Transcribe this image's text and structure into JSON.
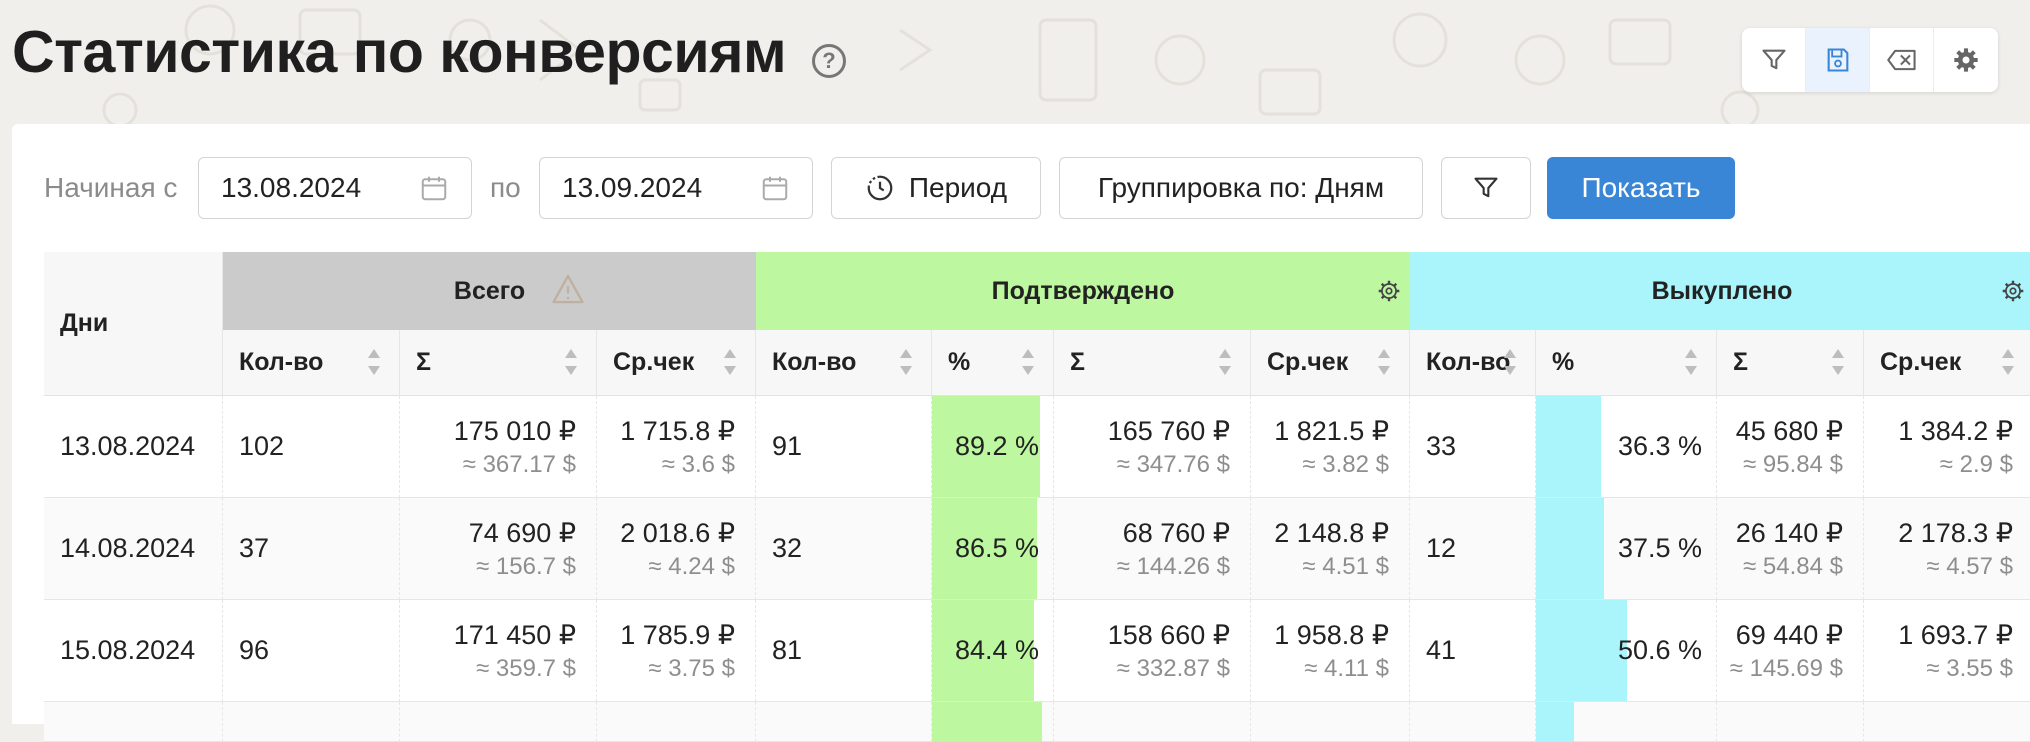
{
  "page": {
    "title": "Статистика по конверсиям"
  },
  "toolbar": {
    "filter_icon": "filter-icon",
    "save_icon": "save-icon",
    "clear_icon": "clear-icon",
    "settings_icon": "gear-icon"
  },
  "filters": {
    "from_label": "Начиная с",
    "from_value": "13.08.2024",
    "to_label": "по",
    "to_value": "13.09.2024",
    "period_label": "Период",
    "grouping_label": "Группировка по: Дням",
    "show_label": "Показать"
  },
  "table": {
    "days_header": "Дни",
    "groups": [
      {
        "label": "Всего",
        "color": "#cbcbcb"
      },
      {
        "label": "Подтверждено",
        "color": "#bdf8a0"
      },
      {
        "label": "Выкуплено",
        "color": "#a9f5fb"
      }
    ],
    "subheaders": [
      "Кол-во",
      "Σ",
      "Ср.чек",
      "Кол-во",
      "%",
      "Σ",
      "Ср.чек",
      "Кол-во",
      "%",
      "Σ",
      "Ср.чек"
    ],
    "rows": [
      {
        "date": "13.08.2024",
        "total": {
          "count": "102",
          "sum": "175 010 ₽",
          "sum_usd": "≈ 367.17 $",
          "avg": "1 715.8 ₽",
          "avg_usd": "≈ 3.6 $"
        },
        "confirmed": {
          "count": "91",
          "pct": "89.2 %",
          "pct_value": 89.2,
          "sum": "165 760 ₽",
          "sum_usd": "≈ 347.76 $",
          "avg": "1 821.5 ₽",
          "avg_usd": "≈ 3.82 $"
        },
        "bought": {
          "count": "33",
          "pct": "36.3 %",
          "pct_value": 36.3,
          "sum": "45 680 ₽",
          "sum_usd": "≈ 95.84 $",
          "avg": "1 384.2 ₽",
          "avg_usd": "≈ 2.9 $"
        }
      },
      {
        "date": "14.08.2024",
        "total": {
          "count": "37",
          "sum": "74 690 ₽",
          "sum_usd": "≈ 156.7 $",
          "avg": "2 018.6 ₽",
          "avg_usd": "≈ 4.24 $"
        },
        "confirmed": {
          "count": "32",
          "pct": "86.5 %",
          "pct_value": 86.5,
          "sum": "68 760 ₽",
          "sum_usd": "≈ 144.26 $",
          "avg": "2 148.8 ₽",
          "avg_usd": "≈ 4.51 $"
        },
        "bought": {
          "count": "12",
          "pct": "37.5 %",
          "pct_value": 37.5,
          "sum": "26 140 ₽",
          "sum_usd": "≈ 54.84 $",
          "avg": "2 178.3 ₽",
          "avg_usd": "≈ 4.57 $"
        }
      },
      {
        "date": "15.08.2024",
        "total": {
          "count": "96",
          "sum": "171 450 ₽",
          "sum_usd": "≈ 359.7 $",
          "avg": "1 785.9 ₽",
          "avg_usd": "≈ 3.75 $"
        },
        "confirmed": {
          "count": "81",
          "pct": "84.4 %",
          "pct_value": 84.4,
          "sum": "158 660 ₽",
          "sum_usd": "≈ 332.87 $",
          "avg": "1 958.8 ₽",
          "avg_usd": "≈ 4.11 $"
        },
        "bought": {
          "count": "41",
          "pct": "50.6 %",
          "pct_value": 50.6,
          "sum": "69 440 ₽",
          "sum_usd": "≈ 145.69 $",
          "avg": "1 693.7 ₽",
          "avg_usd": "≈ 3.55 $"
        }
      }
    ]
  }
}
